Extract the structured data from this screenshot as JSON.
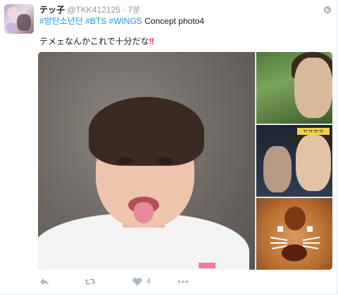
{
  "tweet": {
    "author": {
      "name": "テッ子",
      "handle": "@TKK412125",
      "separator": "·",
      "time": "7분"
    },
    "hashtags": [
      "#방탄소년단",
      "#BTS",
      "#WINGS"
    ],
    "caption": "Concept photo4",
    "body": "テメェなんかこれで十分だな",
    "emoji": "‼"
  },
  "actions": {
    "reply": "reply-icon",
    "retweet": "retweet-icon",
    "like": "heart-icon",
    "like_count": "4",
    "more": "more-icon"
  },
  "thumb_caption": "ㅠㅠㅠㅠ",
  "colors": {
    "link": "#1b95e0",
    "muted": "#8899a6",
    "text": "#14171a",
    "emoji": "#e0245e"
  }
}
